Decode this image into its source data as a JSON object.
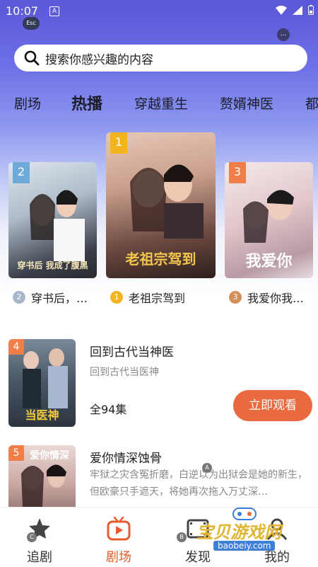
{
  "status_bar": {
    "time": "10:07",
    "badge": "A",
    "esc": "Esc",
    "dots": "..."
  },
  "search": {
    "placeholder": "搜索你感兴趣的内容"
  },
  "categories": [
    {
      "label": "剧场",
      "active": false
    },
    {
      "label": "热播",
      "active": true
    },
    {
      "label": "穿越重生",
      "active": false
    },
    {
      "label": "赘婿神医",
      "active": false
    },
    {
      "label": "都",
      "active": false
    }
  ],
  "top_three": [
    {
      "rank": "2",
      "title": "穿书后，…",
      "poster_text": "穿书后 我成了腹黑",
      "rank_color": "#a9b6c8"
    },
    {
      "rank": "1",
      "title": "老祖宗驾到",
      "poster_text": "老祖宗驾到",
      "rank_color": "#f3b51f"
    },
    {
      "rank": "3",
      "title": "我爱你我…",
      "poster_text": "我爱你",
      "rank_color": "#d2905a"
    }
  ],
  "list": [
    {
      "rank": "4",
      "title": "回到古代当神医",
      "subtitle": "回到古代当医神",
      "episodes": "全94集",
      "button": "立即观看",
      "poster_text": "当医神"
    },
    {
      "rank": "5",
      "title": "爱你情深蚀骨",
      "description": "牢狱之灾含冤折磨，白逆以为出狱会是她的新生，但欧豪只手遮天，将她再次拖入万丈深…",
      "poster_text": "爱你情深"
    }
  ],
  "tabs": [
    {
      "label": "追剧",
      "icon": "star-icon",
      "active": false
    },
    {
      "label": "剧场",
      "icon": "tv-play-icon",
      "active": true
    },
    {
      "label": "发现",
      "icon": "film-icon",
      "active": false
    },
    {
      "label": "我的",
      "icon": "user-icon",
      "active": false
    }
  ],
  "watermark": {
    "text": "宝贝游戏网",
    "url": "baobeiy.com"
  },
  "colors": {
    "accent": "#e86a3e",
    "hero_top": "#5b57d8"
  }
}
